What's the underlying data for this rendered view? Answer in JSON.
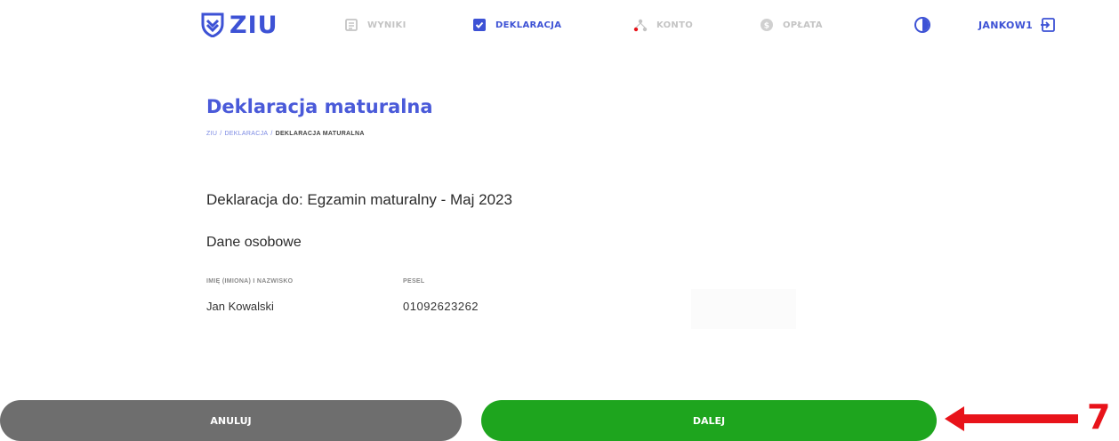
{
  "brand": {
    "logo_text": "ZIU",
    "color": "#3d52d5"
  },
  "nav": {
    "items": [
      {
        "label": "WYNIKI",
        "icon": "results-icon",
        "active": false
      },
      {
        "label": "DEKLARACJA",
        "icon": "checkbox-icon",
        "active": true
      },
      {
        "label": "KONTO",
        "icon": "account-icon",
        "active": false
      },
      {
        "label": "OPŁATA",
        "icon": "payment-icon",
        "active": false
      }
    ],
    "theme_toggle_icon": "contrast-icon",
    "username": "JANKOW1",
    "logout_icon": "logout-icon"
  },
  "page": {
    "title": "Deklaracja maturalna",
    "breadcrumb": [
      "ZIU",
      "DEKLARACJA",
      "DEKLARACJA MATURALNA"
    ],
    "breadcrumb_separator": "/",
    "declaration": "Deklaracja do: Egzamin maturalny - Maj 2023",
    "section_title": "Dane osobowe",
    "fields": [
      {
        "label": "IMIĘ (IMIONA) I NAZWISKO",
        "value": "Jan Kowalski"
      },
      {
        "label": "PESEL",
        "value": "01092623262"
      }
    ]
  },
  "actions": {
    "cancel_label": "ANULUJ",
    "next_label": "DALEJ",
    "cancel_color": "#6e6e6e",
    "next_color": "#1ea51e"
  },
  "annotation": {
    "number": "7",
    "color": "#e8131a"
  }
}
